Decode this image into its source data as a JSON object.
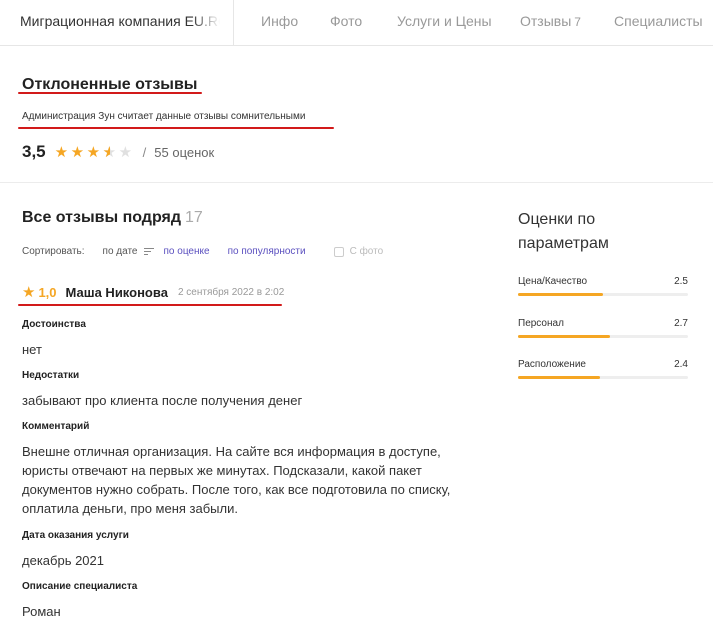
{
  "topbar": {
    "company": "Миграционная компания EU.RO G",
    "nav": [
      {
        "label": "Инфо"
      },
      {
        "label": "Фото"
      },
      {
        "label": "Услуги и Цены"
      },
      {
        "label": "Отзывы",
        "count": "7"
      },
      {
        "label": "Специалисты"
      }
    ]
  },
  "rejected": {
    "title": "Отклоненные отзывы",
    "note": "Администрация Зун считает данные отзывы сомнительными",
    "score": "3,5",
    "rating": 3.5,
    "separator": "/",
    "count": "55 оценок"
  },
  "all_reviews": {
    "title": "Все отзывы подряд",
    "count": "17",
    "sort": {
      "label": "Сортировать:",
      "by_date": "по дате",
      "by_rating": "по оценке",
      "by_popularity": "по популярности",
      "with_photo": "С фото"
    }
  },
  "review": {
    "score": "1,0",
    "author": "Маша Никонова",
    "date": "2 сентября 2022 в 2:02",
    "pros_label": "Достоинства",
    "pros": "нет",
    "cons_label": "Недостатки",
    "cons": "забывают про клиента после получения денег",
    "comment_label": "Комментарий",
    "comment": "Внешне отличная организация. На сайте вся информация в доступе, юристы отвечают на первых же минутах. Подсказали, какой пакет документов нужно собрать. После того, как все подготовила по списку, оплатила деньги, про меня забыли.",
    "date_label": "Дата оказания услуги",
    "service_date": "декабрь 2021",
    "specialist_label": "Описание специалиста",
    "specialist": "Роман"
  },
  "params": {
    "title": "Оценки по параметрам",
    "items": [
      {
        "label": "Цена/Качество",
        "value": "2.5",
        "fraction": 0.5
      },
      {
        "label": "Персонал",
        "value": "2.7",
        "fraction": 0.54
      },
      {
        "label": "Расположение",
        "value": "2.4",
        "fraction": 0.48
      }
    ]
  },
  "colors": {
    "accent": "#f5a623",
    "link": "#5a4fbf",
    "underline": "#d21a1a"
  }
}
